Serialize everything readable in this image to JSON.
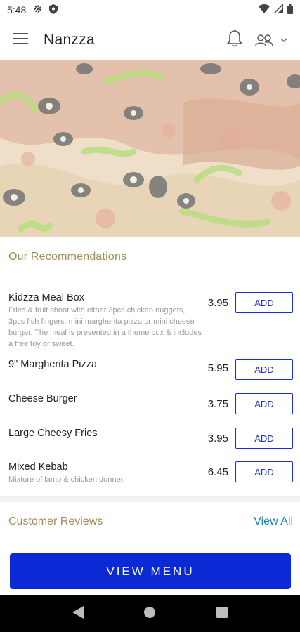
{
  "status_bar": {
    "time": "5:48"
  },
  "app_bar": {
    "title": "Nanzza"
  },
  "recommendations": {
    "title": "Our Recommendations",
    "items": [
      {
        "name": "Kidzza Meal Box",
        "description": "Fries & fruit shoot with either 3pcs chicken nuggets, 3pcs fish fingers, mini margherita pizza or mini cheese burger. The meal is presented in a theme box & includes a free toy or sweet.",
        "price": "3.95",
        "add_label": "ADD"
      },
      {
        "name": "9\" Margherita Pizza",
        "description": "",
        "price": "5.95",
        "add_label": "ADD"
      },
      {
        "name": "Cheese Burger",
        "description": "",
        "price": "3.75",
        "add_label": "ADD"
      },
      {
        "name": "Large Cheesy Fries",
        "description": "",
        "price": "3.95",
        "add_label": "ADD"
      },
      {
        "name": "Mixed Kebab",
        "description": "Mixture of lamb & chicken donner.",
        "price": "6.45",
        "add_label": "ADD"
      }
    ]
  },
  "reviews": {
    "title": "Customer Reviews",
    "view_all": "View All"
  },
  "cta": {
    "label": "VIEW MENU"
  },
  "colors": {
    "accent": "#0b2ad6",
    "section_title": "#a28a5a",
    "link": "#1e7fb3"
  }
}
